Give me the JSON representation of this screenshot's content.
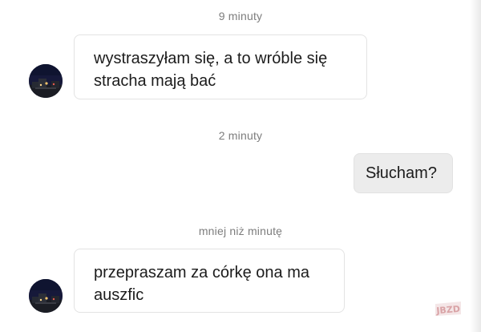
{
  "conversation": {
    "messages": [
      {
        "id": "m1",
        "timestamp": "9 minuty",
        "direction": "incoming",
        "lines": [
          "wystraszyłam się, a to wróble się",
          "stracha mają bać"
        ]
      },
      {
        "id": "m2",
        "timestamp": "2 minuty",
        "direction": "outgoing",
        "lines": [
          "Słucham?"
        ]
      },
      {
        "id": "m3",
        "timestamp": "mniej niż minutę",
        "direction": "incoming",
        "lines": [
          "przepraszam za córkę ona ma",
          "auszfic"
        ]
      }
    ]
  },
  "watermark": {
    "text": "JBZD"
  },
  "colors": {
    "timestamp_text": "#7d7d7d",
    "message_text": "#1c1c1c",
    "incoming_bubble": "#ffffff",
    "outgoing_bubble": "#ececec",
    "bubble_border": "#e3e3e3",
    "watermark_accent": "#d9a3a6"
  },
  "icons": {
    "avatar": "contact-avatar-night-city-photo",
    "watermark": "jbzd-logo"
  }
}
